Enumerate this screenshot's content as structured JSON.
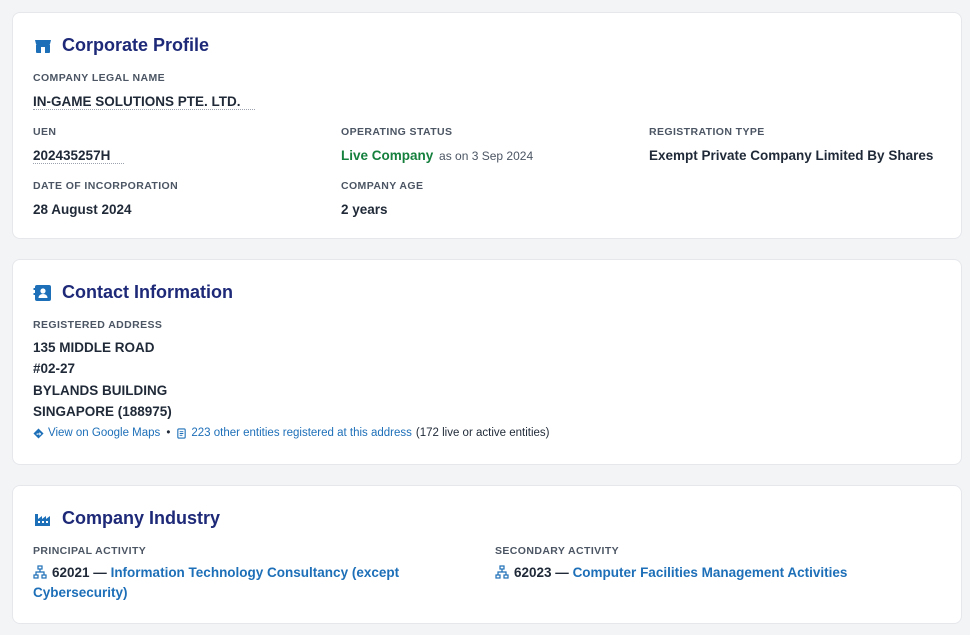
{
  "profile": {
    "title": "Corporate Profile",
    "legal_name_label": "COMPANY LEGAL NAME",
    "legal_name": "IN-GAME SOLUTIONS PTE. LTD.",
    "uen_label": "UEN",
    "uen": "202435257H",
    "status_label": "OPERATING STATUS",
    "status": "Live Company",
    "status_note": "as on 3 Sep 2024",
    "reg_type_label": "REGISTRATION TYPE",
    "reg_type": "Exempt Private Company Limited By Shares",
    "incorp_label": "DATE OF INCORPORATION",
    "incorp_date": "28 August 2024",
    "age_label": "COMPANY AGE",
    "age": "2 years"
  },
  "contact": {
    "title": "Contact Information",
    "address_label": "REGISTERED ADDRESS",
    "address_lines": [
      "135 MIDDLE ROAD",
      "#02-27",
      "BYLANDS BUILDING",
      "SINGAPORE (188975)"
    ],
    "maps_link": "View on Google Maps",
    "bullet": "•",
    "entities_link": "223 other entities registered at this address",
    "entities_note": "(172 live or active entities)"
  },
  "industry": {
    "title": "Company Industry",
    "principal_label": "PRINCIPAL ACTIVITY",
    "principal_code": "62021 —",
    "principal_desc": "Information Technology Consultancy (except Cybersecurity)",
    "secondary_label": "SECONDARY ACTIVITY",
    "secondary_code": "62023 —",
    "secondary_desc": "Computer Facilities Management Activities"
  },
  "colors": {
    "title": "#1e2a78",
    "link": "#1d6fb8",
    "live": "#15803d",
    "icon": "#1d6fb8"
  },
  "icons": {
    "profile": "storefront-icon",
    "contact": "contact-card-icon",
    "industry": "factory-icon",
    "maps": "directions-icon",
    "entities": "document-list-icon",
    "activity": "hierarchy-icon"
  }
}
